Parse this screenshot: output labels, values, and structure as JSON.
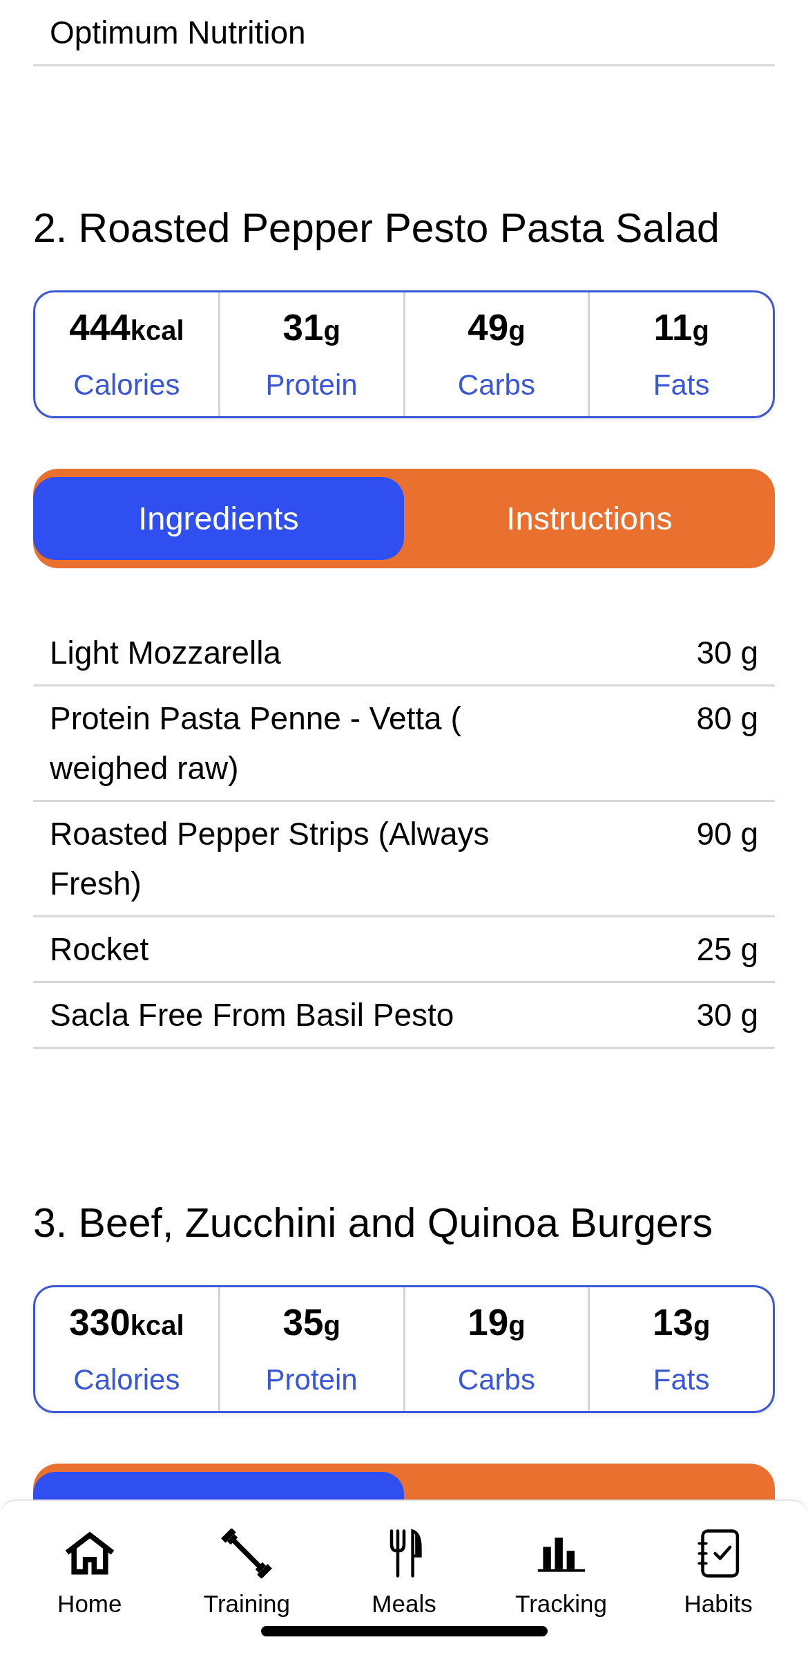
{
  "previous_ingredients": [
    {
      "name": "Optimum Nutrition"
    }
  ],
  "meals": [
    {
      "title": "2. Roasted Pepper Pesto Pasta Salad",
      "macros": [
        {
          "value": "444",
          "unit": "kcal",
          "label": "Calories"
        },
        {
          "value": "31",
          "unit": "g",
          "label": "Protein"
        },
        {
          "value": "49",
          "unit": "g",
          "label": "Carbs"
        },
        {
          "value": "11",
          "unit": "g",
          "label": "Fats"
        }
      ],
      "tabs": [
        {
          "label": "Ingredients",
          "selected": true
        },
        {
          "label": "Instructions",
          "selected": false
        }
      ],
      "ingredients": [
        {
          "name": "Light Mozzarella",
          "amount": "30 g"
        },
        {
          "name": "Protein Pasta Penne - Vetta ( weighed raw)",
          "amount": "80 g"
        },
        {
          "name": "Roasted Pepper Strips (Always Fresh)",
          "amount": "90 g"
        },
        {
          "name": "Rocket",
          "amount": "25 g"
        },
        {
          "name": "Sacla Free From Basil Pesto",
          "amount": "30 g"
        }
      ]
    },
    {
      "title": "3. Beef, Zucchini and Quinoa Burgers",
      "macros": [
        {
          "value": "330",
          "unit": "kcal",
          "label": "Calories"
        },
        {
          "value": "35",
          "unit": "g",
          "label": "Protein"
        },
        {
          "value": "19",
          "unit": "g",
          "label": "Carbs"
        },
        {
          "value": "13",
          "unit": "g",
          "label": "Fats"
        }
      ],
      "tabs": [
        {
          "selected": true
        },
        {
          "selected": false
        }
      ]
    }
  ],
  "nav": [
    {
      "label": "Home",
      "kind": "home"
    },
    {
      "label": "Training",
      "kind": "dumbbell"
    },
    {
      "label": "Meals",
      "kind": "cutlery"
    },
    {
      "label": "Tracking",
      "kind": "chart"
    },
    {
      "label": "Habits",
      "kind": "checklist"
    }
  ]
}
